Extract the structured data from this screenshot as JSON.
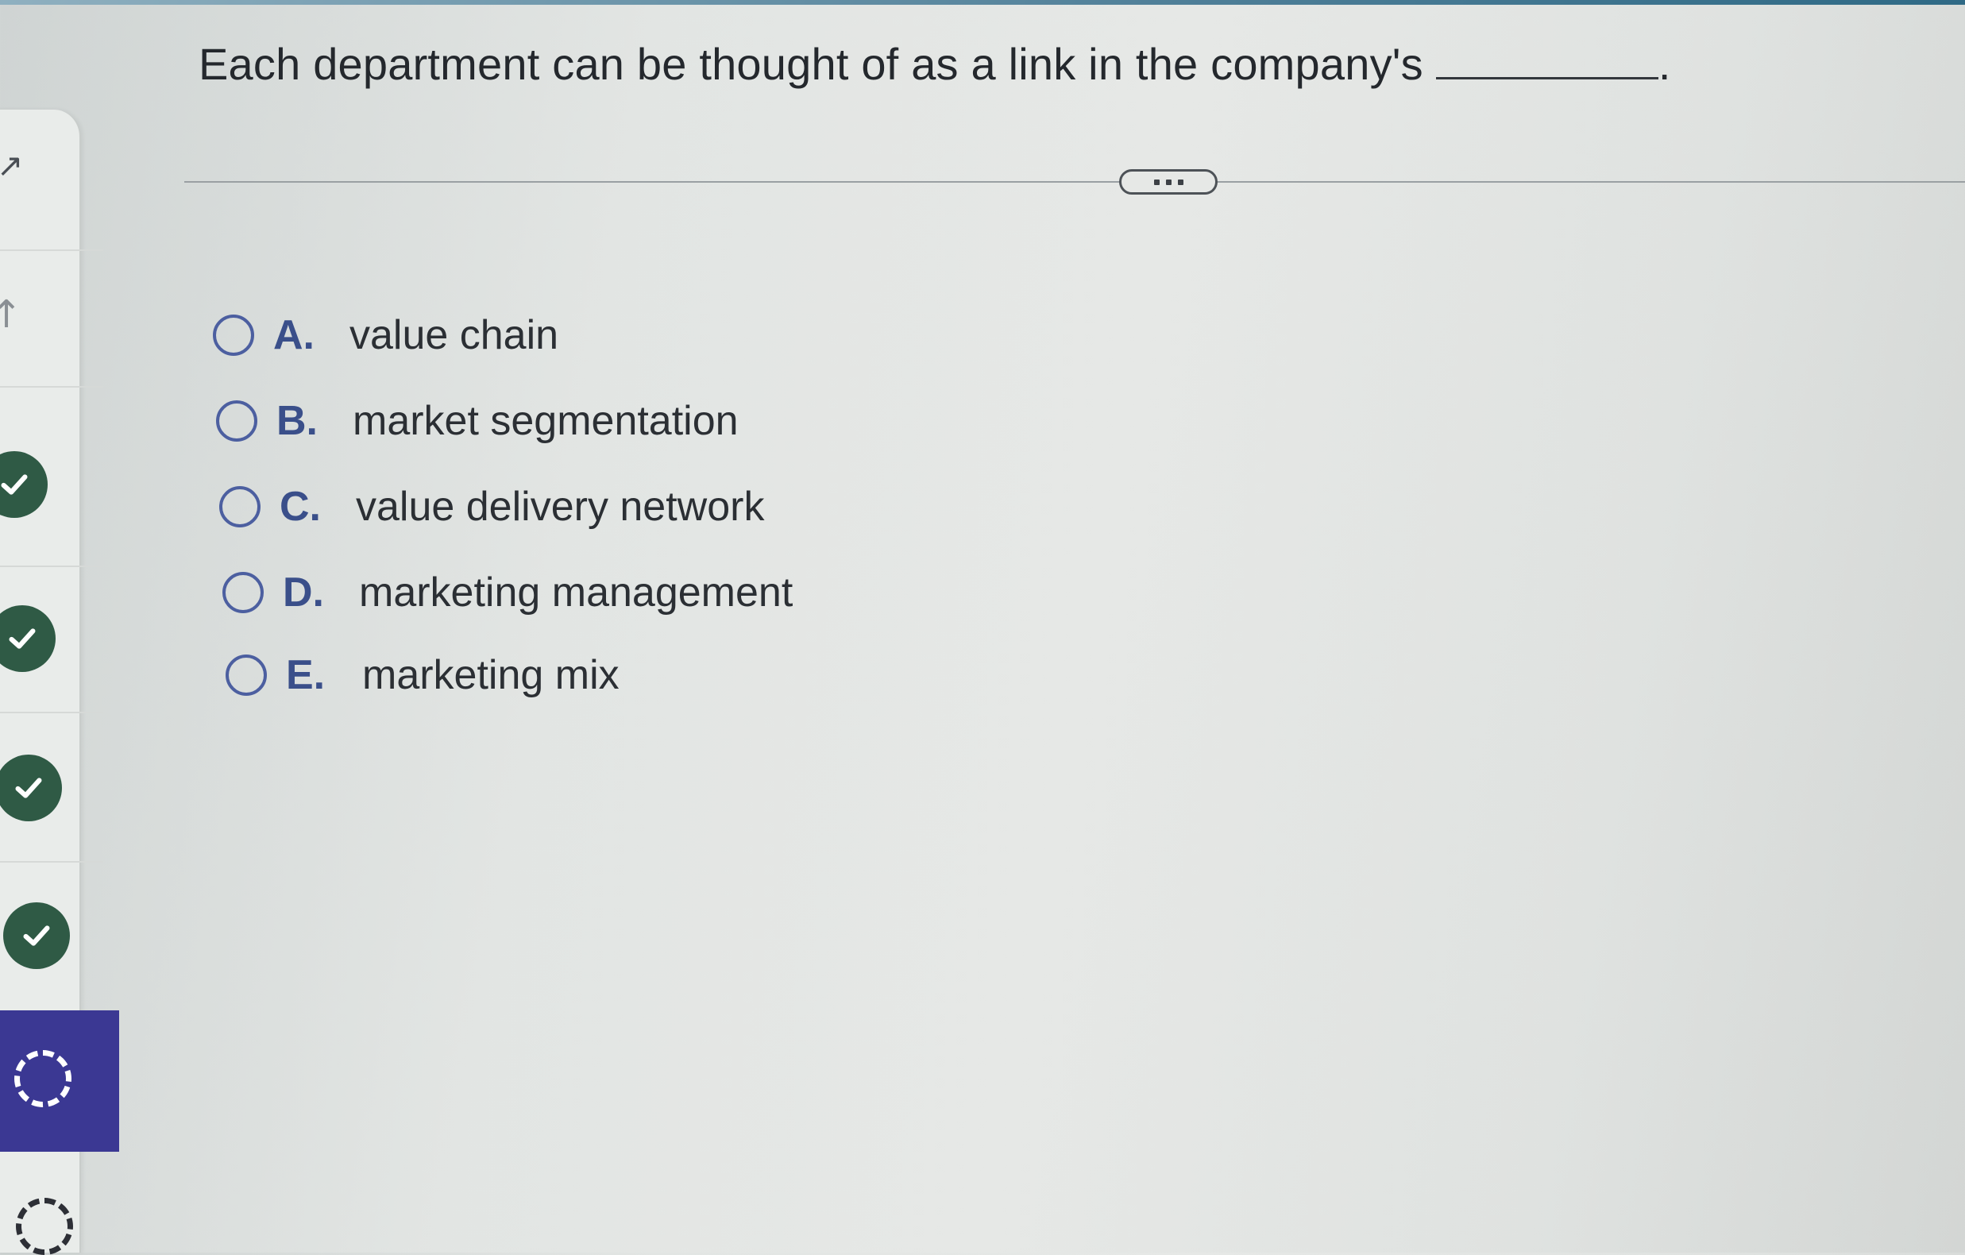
{
  "question": {
    "text": "Each department can be thought of as a link in the company's",
    "end_punct": "."
  },
  "options": [
    {
      "letter": "A.",
      "text": "value chain",
      "selected": false
    },
    {
      "letter": "B.",
      "text": "market segmentation",
      "selected": false
    },
    {
      "letter": "C.",
      "text": "value delivery network",
      "selected": false
    },
    {
      "letter": "D.",
      "text": "marketing management",
      "selected": false
    },
    {
      "letter": "E.",
      "text": "marketing mix",
      "selected": false
    }
  ],
  "sidebar": {
    "glyphs": {
      "expand": "↗",
      "up": "↑"
    },
    "completed_count": 4,
    "colors": {
      "completed": "#2f5a45",
      "active_bg": "#3b3893"
    }
  },
  "colors": {
    "radio_border": "#4c5fa0",
    "letter": "#3a4f8a",
    "text": "#2a2e33"
  },
  "more_button_icon": "ellipsis-icon"
}
